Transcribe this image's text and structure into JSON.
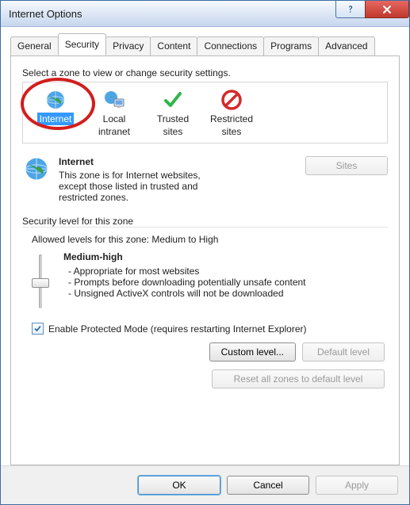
{
  "window": {
    "title": "Internet Options"
  },
  "titlebar_icons": {
    "help": "help-icon",
    "close": "close-icon"
  },
  "tabs": [
    {
      "label": "General"
    },
    {
      "label": "Security",
      "active": true
    },
    {
      "label": "Privacy"
    },
    {
      "label": "Content"
    },
    {
      "label": "Connections"
    },
    {
      "label": "Programs"
    },
    {
      "label": "Advanced"
    }
  ],
  "security": {
    "instruction": "Select a zone to view or change security settings.",
    "zones": [
      {
        "icon": "globe-icon",
        "label": "Internet",
        "selected": true
      },
      {
        "icon": "globe-monitor-icon",
        "label_line1": "Local",
        "label_line2": "intranet"
      },
      {
        "icon": "check-green-icon",
        "label_line1": "Trusted",
        "label_line2": "sites"
      },
      {
        "icon": "no-entry-icon",
        "label_line1": "Restricted",
        "label_line2": "sites"
      }
    ],
    "selected_zone": {
      "icon": "globe-icon",
      "name": "Internet",
      "desc_line1": "This zone is for Internet websites,",
      "desc_line2": "except those listed in trusted and",
      "desc_line3": "restricted zones."
    },
    "sites_button": "Sites",
    "level_group_label": "Security level for this zone",
    "allowed_levels": "Allowed levels for this zone: Medium to High",
    "current_level": {
      "name": "Medium-high",
      "bullets": [
        "- Appropriate for most websites",
        "- Prompts before downloading potentially unsafe content",
        "- Unsigned ActiveX controls will not be downloaded"
      ]
    },
    "protected_mode": {
      "checked": true,
      "label": "Enable Protected Mode (requires restarting Internet Explorer)"
    },
    "buttons": {
      "custom": "Custom level...",
      "default": "Default level",
      "reset": "Reset all zones to default level"
    }
  },
  "dialog_buttons": {
    "ok": "OK",
    "cancel": "Cancel",
    "apply": "Apply"
  }
}
